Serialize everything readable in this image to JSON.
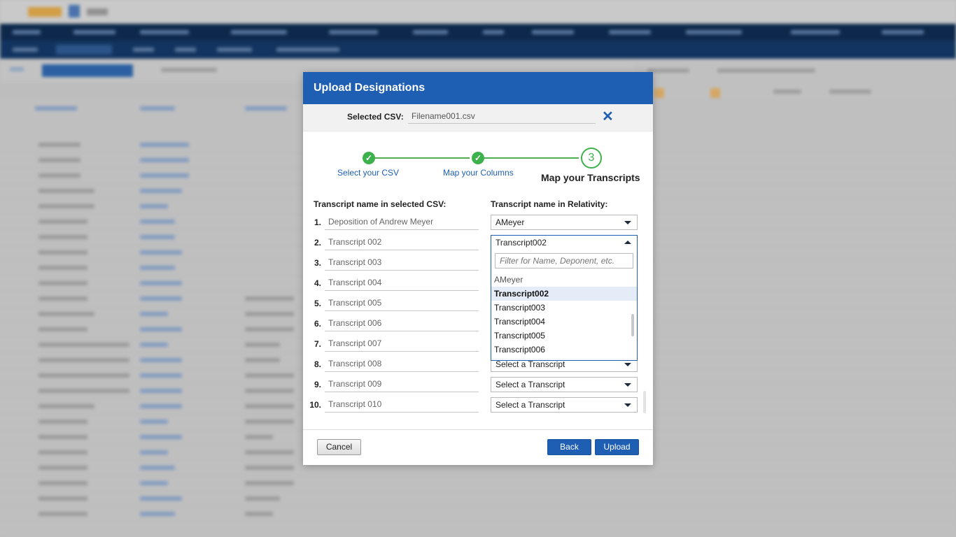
{
  "modal": {
    "title": "Upload Designations",
    "selected_csv_label": "Selected CSV:",
    "selected_csv_value": "Filename001.csv",
    "close_glyph": "✕"
  },
  "steps": [
    {
      "label": "Select your CSV",
      "status": "done",
      "glyph": "✓"
    },
    {
      "label": "Map your Columns",
      "status": "done",
      "glyph": "✓"
    },
    {
      "label": "Map your Transcripts",
      "status": "active",
      "number": "3"
    }
  ],
  "columns": {
    "csv_header": "Transcript name in selected CSV:",
    "relativity_header": "Transcript name in Relativity:"
  },
  "rows": [
    {
      "num": "1.",
      "csv_name": "Deposition of Andrew Meyer",
      "selection": "AMeyer"
    },
    {
      "num": "2.",
      "csv_name": "Transcript 002",
      "selection": "Transcript002"
    },
    {
      "num": "3.",
      "csv_name": "Transcript 003",
      "selection": ""
    },
    {
      "num": "4.",
      "csv_name": "Transcript 004",
      "selection": ""
    },
    {
      "num": "5.",
      "csv_name": "Transcript 005",
      "selection": ""
    },
    {
      "num": "6.",
      "csv_name": "Transcript 006",
      "selection": ""
    },
    {
      "num": "7.",
      "csv_name": "Transcript 007",
      "selection": ""
    },
    {
      "num": "8.",
      "csv_name": "Transcript 008",
      "selection": "Select a Transcript"
    },
    {
      "num": "9.",
      "csv_name": "Transcript 009",
      "selection": "Select a Transcript"
    },
    {
      "num": "10.",
      "csv_name": "Transcript 010",
      "selection": "Select a Transcript"
    }
  ],
  "dropdown": {
    "filter_placeholder": "Filter for Name, Deponent, etc.",
    "options": [
      "AMeyer",
      "Transcript002",
      "Transcript003",
      "Transcript004",
      "Transcript005",
      "Transcript006"
    ],
    "selected": "Transcript002"
  },
  "buttons": {
    "cancel": "Cancel",
    "back": "Back",
    "upload": "Upload"
  },
  "colors": {
    "header_blue": "#1f5fb3",
    "step_green": "#3db14b"
  }
}
